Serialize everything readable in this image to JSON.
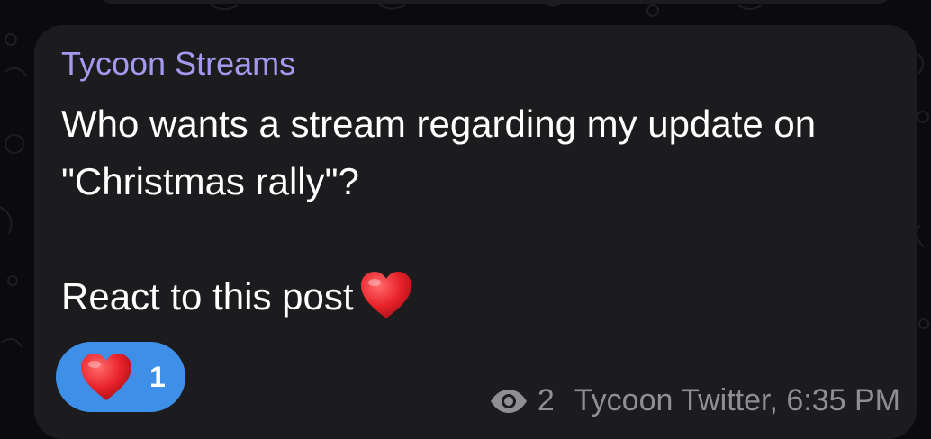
{
  "message": {
    "sender": "Tycoon Streams",
    "text": "Who wants a stream regarding my update on \"Christmas rally\"?\n\nReact to this post",
    "inline_emoji": "heart-emoji"
  },
  "reaction": {
    "emoji": "heart-emoji",
    "count": "1"
  },
  "meta": {
    "views": "2",
    "signature_time": "Tycoon Twitter, 6:35 PM",
    "views_icon": "eye-icon"
  },
  "colors": {
    "bubble": "#1c1c1e",
    "sender": "#a39af0",
    "reaction_pill": "#3e8fe8",
    "meta_text": "#8e8e93"
  }
}
